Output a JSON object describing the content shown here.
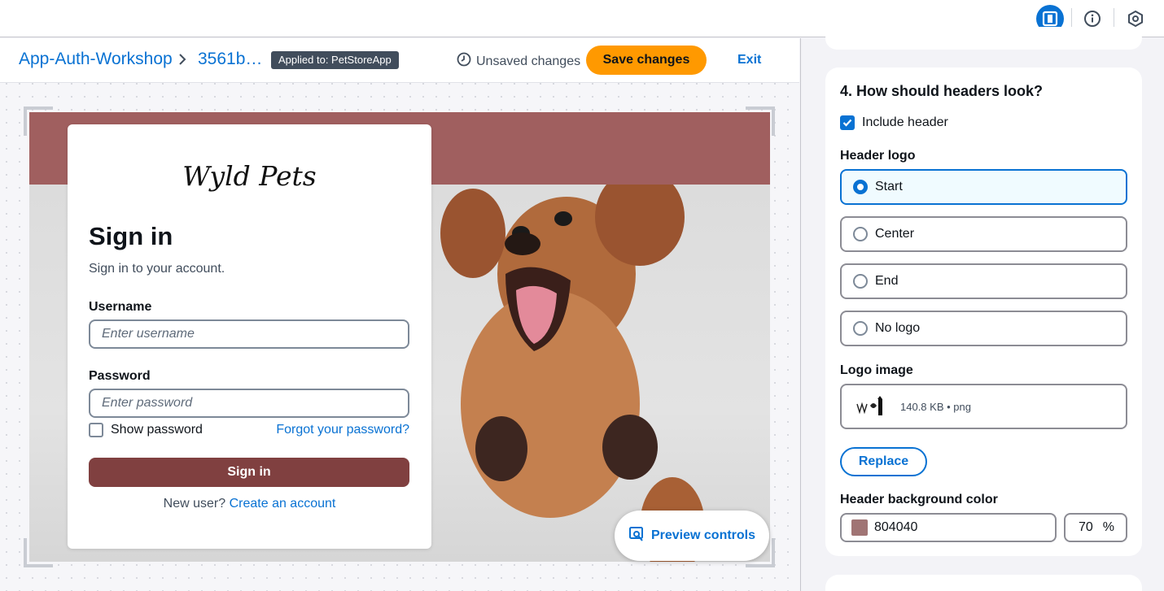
{
  "breadcrumb": {
    "app": "App-Auth-Workshop",
    "branch": "3561b…"
  },
  "applied_badge": "Applied to: PetStoreApp",
  "status": {
    "unsaved": "Unsaved changes"
  },
  "actions": {
    "save": "Save changes",
    "exit": "Exit"
  },
  "preview": {
    "logo_text": "Wyld Pets",
    "title": "Sign in",
    "subtitle": "Sign in to your account.",
    "username_label": "Username",
    "username_placeholder": "Enter username",
    "password_label": "Password",
    "password_placeholder": "Enter password",
    "show_password": "Show password",
    "forgot": "Forgot your password?",
    "signin_button": "Sign in",
    "new_user": "New user?",
    "create_account": "Create an account",
    "header_color": "#a05f5f",
    "button_color": "#804040"
  },
  "preview_controls": "Preview controls",
  "panel": {
    "title": "4. How should headers look?",
    "include_header": "Include header",
    "include_header_checked": true,
    "header_logo_label": "Header logo",
    "logo_options": [
      "Start",
      "Center",
      "End",
      "No logo"
    ],
    "selected_option": "Start",
    "logo_image_label": "Logo image",
    "logo_file_meta": "140.8 KB • png",
    "replace": "Replace",
    "bg_color_label": "Header background color",
    "bg_color_value": "804040",
    "bg_color_swatch": "#a07474",
    "opacity_value": "70",
    "opacity_unit": "%"
  },
  "colors": {
    "accent": "#0972d3",
    "primary_button": "#ff9900"
  }
}
